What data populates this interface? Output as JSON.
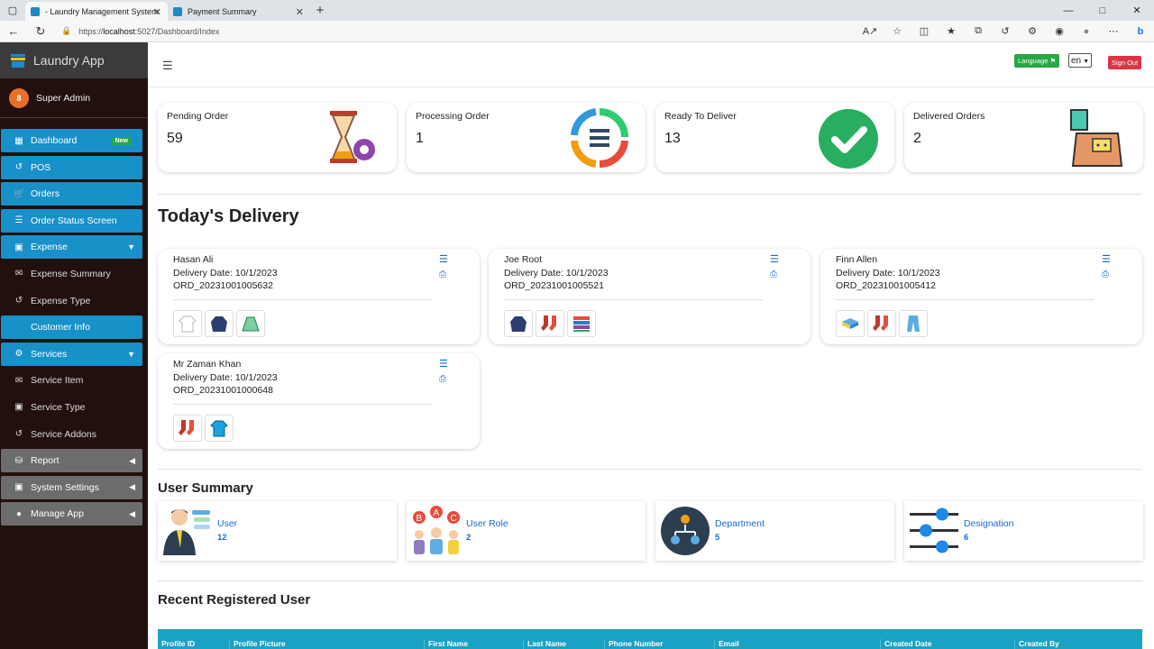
{
  "browser": {
    "tabs": [
      {
        "title": "- Laundry Management System",
        "active": true
      },
      {
        "title": "Payment Summary",
        "active": false
      }
    ],
    "url_prefix": "https://",
    "url_host": "localhost",
    "url_rest": ":5027/Dashboard/Index"
  },
  "sidebar": {
    "brand": "Laundry App",
    "user": "Super Admin",
    "items": [
      {
        "label": "Dashboard",
        "icon": "grid-icon",
        "style": "blue",
        "badge": "New"
      },
      {
        "label": "POS",
        "icon": "history-icon",
        "style": "blue"
      },
      {
        "label": "Orders",
        "icon": "cart-icon",
        "style": "blue"
      },
      {
        "label": "Order Status Screen",
        "icon": "list-icon",
        "style": "blue"
      },
      {
        "label": "Expense",
        "icon": "monitor-icon",
        "style": "blue",
        "chevron": "down"
      },
      {
        "label": "Expense Summary",
        "icon": "envelope-icon",
        "style": "plain"
      },
      {
        "label": "Expense Type",
        "icon": "history-icon",
        "style": "plain"
      },
      {
        "label": "Customer Info",
        "icon": "",
        "style": "blue"
      },
      {
        "label": "Services",
        "icon": "gear-icon",
        "style": "blue",
        "chevron": "down"
      },
      {
        "label": "Service Item",
        "icon": "envelope-icon",
        "style": "plain"
      },
      {
        "label": "Service Type",
        "icon": "monitor-icon",
        "style": "plain"
      },
      {
        "label": "Service Addons",
        "icon": "history-icon",
        "style": "plain"
      },
      {
        "label": "Report",
        "icon": "database-icon",
        "style": "grey",
        "chevron": "left"
      },
      {
        "label": "System Settings",
        "icon": "robot-icon",
        "style": "grey",
        "chevron": "left"
      },
      {
        "label": "Manage App",
        "icon": "users-icon",
        "style": "grey",
        "chevron": "left"
      }
    ]
  },
  "topbar": {
    "language_label": "Language",
    "language_value": "en",
    "signout_label": "Sign Out"
  },
  "stats": [
    {
      "label": "Pending Order",
      "value": "59",
      "icon": "hourglass-gear-icon"
    },
    {
      "label": "Processing Order",
      "value": "1",
      "icon": "cycle-list-icon"
    },
    {
      "label": "Ready To Deliver",
      "value": "13",
      "icon": "check-circle-icon"
    },
    {
      "label": "Delivered Orders",
      "value": "2",
      "icon": "laundry-bag-icon"
    }
  ],
  "today_delivery": {
    "title": "Today's Delivery",
    "cards": [
      {
        "name": "Hasan Ali",
        "date": "Delivery Date: 10/1/2023",
        "order": "ORD_20231001005632",
        "items": [
          "shirt-icon",
          "jacket-icon",
          "skirt-icon"
        ]
      },
      {
        "name": "Joe Root",
        "date": "Delivery Date: 10/1/2023",
        "order": "ORD_20231001005521",
        "items": [
          "jacket-icon",
          "socks-icon",
          "towels-icon"
        ]
      },
      {
        "name": "Finn Allen",
        "date": "Delivery Date: 10/1/2023",
        "order": "ORD_20231001005412",
        "items": [
          "folded-clothes-icon",
          "socks-icon",
          "jeans-icon"
        ]
      },
      {
        "name": "Mr Zaman Khan",
        "date": "Delivery Date: 10/1/2023",
        "order": "ORD_20231001000648",
        "items": [
          "socks-icon",
          "tshirt-icon"
        ]
      }
    ]
  },
  "user_summary": {
    "title": "User Summary",
    "cards": [
      {
        "label": "User",
        "value": "12",
        "icon": "businessman-icon"
      },
      {
        "label": "User Role",
        "value": "2",
        "icon": "abc-roles-icon"
      },
      {
        "label": "Department",
        "value": "5",
        "icon": "org-chart-icon"
      },
      {
        "label": "Designation",
        "value": "6",
        "icon": "sliders-icon"
      }
    ]
  },
  "recent_users": {
    "title": "Recent Registered User",
    "columns": [
      "Profile ID",
      "Profile Picture",
      "First Name",
      "Last Name",
      "Phone Number",
      "Email",
      "Created Date",
      "Created By"
    ]
  }
}
